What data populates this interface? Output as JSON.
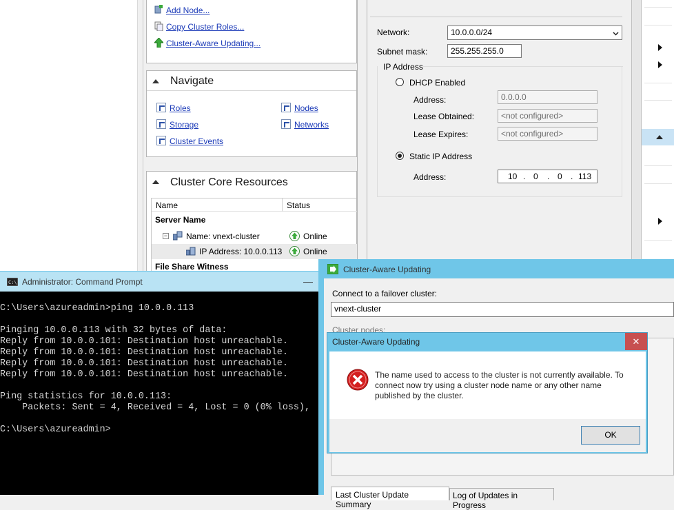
{
  "actions": {
    "add_node": "Add Node...",
    "copy_roles": "Copy Cluster Roles...",
    "cau": "Cluster-Aware Updating..."
  },
  "navigate": {
    "title": "Navigate",
    "roles": "Roles",
    "storage": "Storage",
    "cluster_events": "Cluster Events",
    "nodes": "Nodes",
    "networks": "Networks"
  },
  "core_resources": {
    "title": "Cluster Core Resources",
    "col_name": "Name",
    "col_status": "Status",
    "group_server": "Server Name",
    "row_name": "Name: vnext-cluster",
    "row_name_status": "Online",
    "row_ip": "IP Address: 10.0.0.113",
    "row_ip_status": "Online",
    "group_fsw": "File Share Witness"
  },
  "ip_props": {
    "network_label": "Network:",
    "network_value": "10.0.0.0/24",
    "subnet_label": "Subnet mask:",
    "subnet_value": "255.255.255.0",
    "group_title": "IP Address",
    "dhcp_label": "DHCP Enabled",
    "address_label": "Address:",
    "dhcp_address": "0.0.0.0",
    "lease_obtained_label": "Lease Obtained:",
    "lease_obtained": "<not configured>",
    "lease_expires_label": "Lease Expires:",
    "lease_expires": "<not configured>",
    "static_label": "Static IP Address",
    "static_address_label": "Address:",
    "octet1": "10",
    "octet2": "0",
    "octet3": "0",
    "octet4": "113",
    "dot": "."
  },
  "cmd": {
    "title": "Administrator: Command Prompt",
    "minimize": "—",
    "lines": [
      "C:\\Users\\azureadmin>ping 10.0.0.113",
      "",
      "Pinging 10.0.0.113 with 32 bytes of data:",
      "Reply from 10.0.0.101: Destination host unreachable.",
      "Reply from 10.0.0.101: Destination host unreachable.",
      "Reply from 10.0.0.101: Destination host unreachable.",
      "Reply from 10.0.0.101: Destination host unreachable.",
      "",
      "Ping statistics for 10.0.0.113:",
      "    Packets: Sent = 4, Received = 4, Lost = 0 (0% loss),",
      "",
      "C:\\Users\\azureadmin>"
    ]
  },
  "cau_window": {
    "title": "Cluster-Aware Updating",
    "connect_label": "Connect to a failover cluster:",
    "cluster_value": "vnext-cluster",
    "nodes_label": "Cluster nodes:",
    "tab1": "Last Cluster Update Summary",
    "tab2": "Log of Updates in Progress"
  },
  "error_dialog": {
    "title": "Cluster-Aware Updating",
    "close": "✕",
    "message": "The name used to access to the cluster is not currently available. To connect now try using a cluster node name or any other name published by the cluster.",
    "ok": "OK"
  },
  "colors": {
    "link": "#1c3bb8",
    "titlebar_active": "#6fc6e8",
    "titlebar_light": "#b9e3f4",
    "close_red": "#c75050",
    "error_red": "#d42020"
  }
}
